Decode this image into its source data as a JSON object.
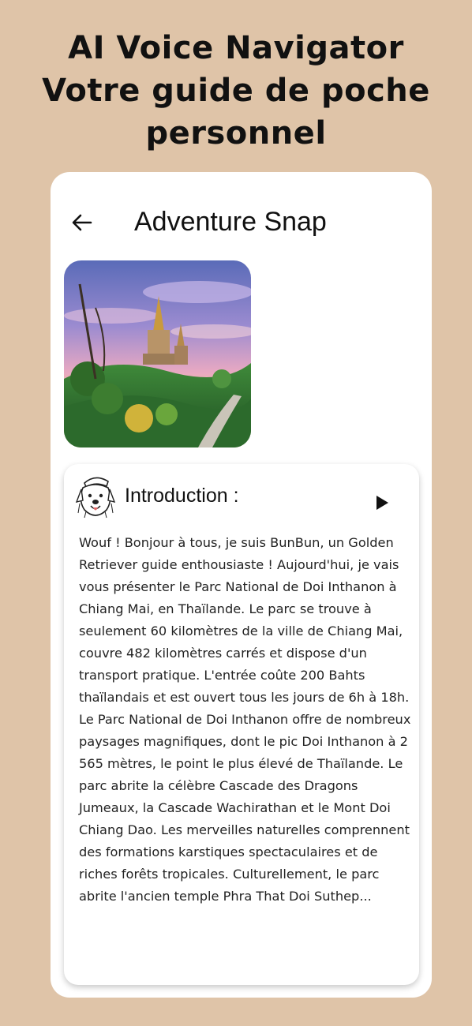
{
  "headline": {
    "line1": "AI Voice Navigator",
    "line2": "Votre guide de poche",
    "line3": "personnel"
  },
  "app": {
    "back_icon": "arrow-left-icon",
    "title": "Adventure Snap"
  },
  "photo": {
    "subject": "temple-landscape-photo"
  },
  "intro": {
    "avatar_icon": "dog-avatar-icon",
    "heading": "Introduction :",
    "play_icon": "play-icon",
    "paragraph1": "Wouf ! Bonjour à tous, je suis BunBun, un Golden Retriever guide enthousiaste ! Aujourd'hui, je vais vous présenter le Parc National de Doi Inthanon à Chiang Mai, en Thaïlande. Le parc se trouve à seulement 60 kilomètres de la ville de Chiang Mai, couvre 482 kilomètres carrés et dispose d'un transport pratique. L'entrée coûte 200 Bahts thaïlandais et est ouvert tous les jours de 6h à 18h.",
    "paragraph2": "Le Parc National de Doi Inthanon offre de nombreux paysages magnifiques, dont le pic Doi Inthanon à 2 565 mètres, le point le plus élevé de Thaïlande. Le parc abrite la célèbre Cascade des Dragons Jumeaux, la Cascade Wachirathan et le Mont Doi Chiang Dao. Les merveilles naturelles comprennent des formations karstiques spectaculaires et de riches forêts tropicales. Culturellement, le parc abrite l'ancien temple Phra That Doi Suthep..."
  },
  "colors": {
    "background": "#dfc4a8",
    "card": "#ffffff",
    "text": "#111111"
  }
}
